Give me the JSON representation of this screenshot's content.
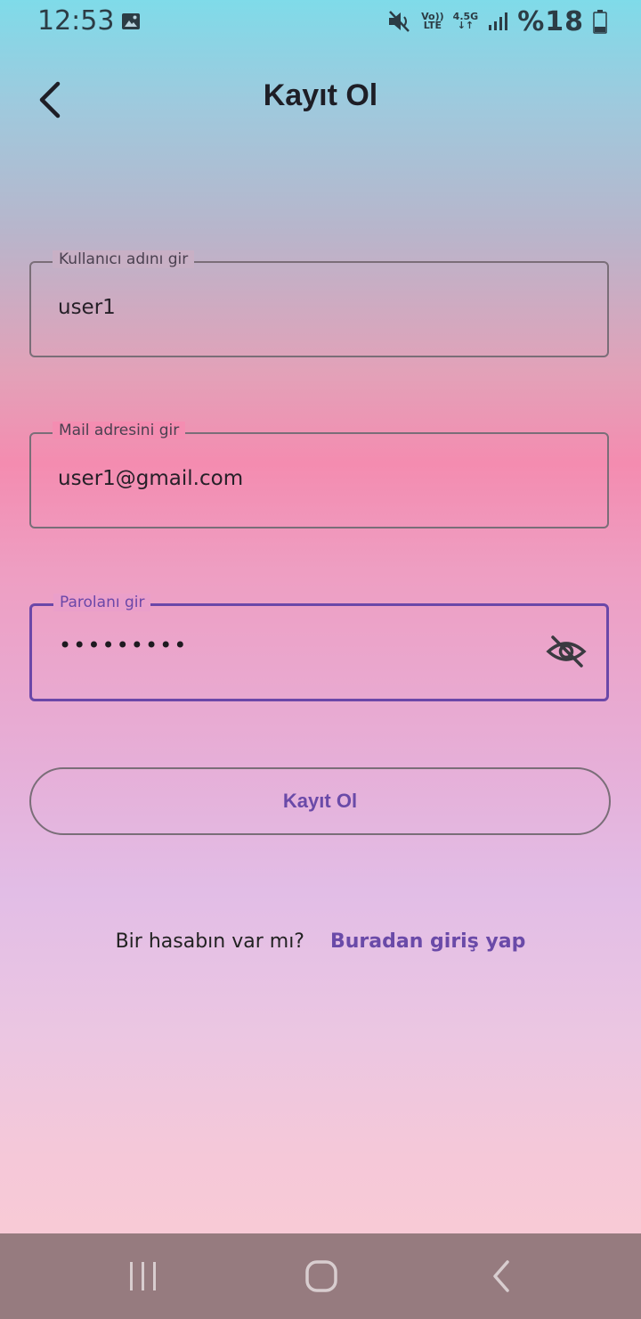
{
  "status_bar": {
    "time": "12:53",
    "volte_top": "Vo))",
    "volte_bottom": "LTE",
    "network": "4.5G",
    "battery": "%18",
    "icons": [
      "gallery-icon",
      "mute-icon",
      "volte-icon",
      "network-arrows-icon",
      "signal-icon",
      "battery-icon"
    ]
  },
  "header": {
    "title": "Kayıt Ol",
    "back_icon": "back-arrow-icon"
  },
  "form": {
    "username": {
      "label": "Kullanıcı adını gir",
      "value": "user1"
    },
    "email": {
      "label": "Mail adresini gir",
      "value": "user1@gmail.com"
    },
    "password": {
      "label": "Parolanı gir",
      "value": "•••••••••",
      "toggle_icon": "eye-off-icon"
    },
    "submit_label": "Kayıt Ol"
  },
  "login_prompt": {
    "question": "Bir hasabın var mı?",
    "link": "Buradan giriş yap"
  },
  "nav_bar": {
    "buttons": [
      "recent-apps-icon",
      "home-icon",
      "back-icon"
    ]
  },
  "colors": {
    "accent": "#6a4aa8",
    "nav_bar": "#967b7f"
  }
}
